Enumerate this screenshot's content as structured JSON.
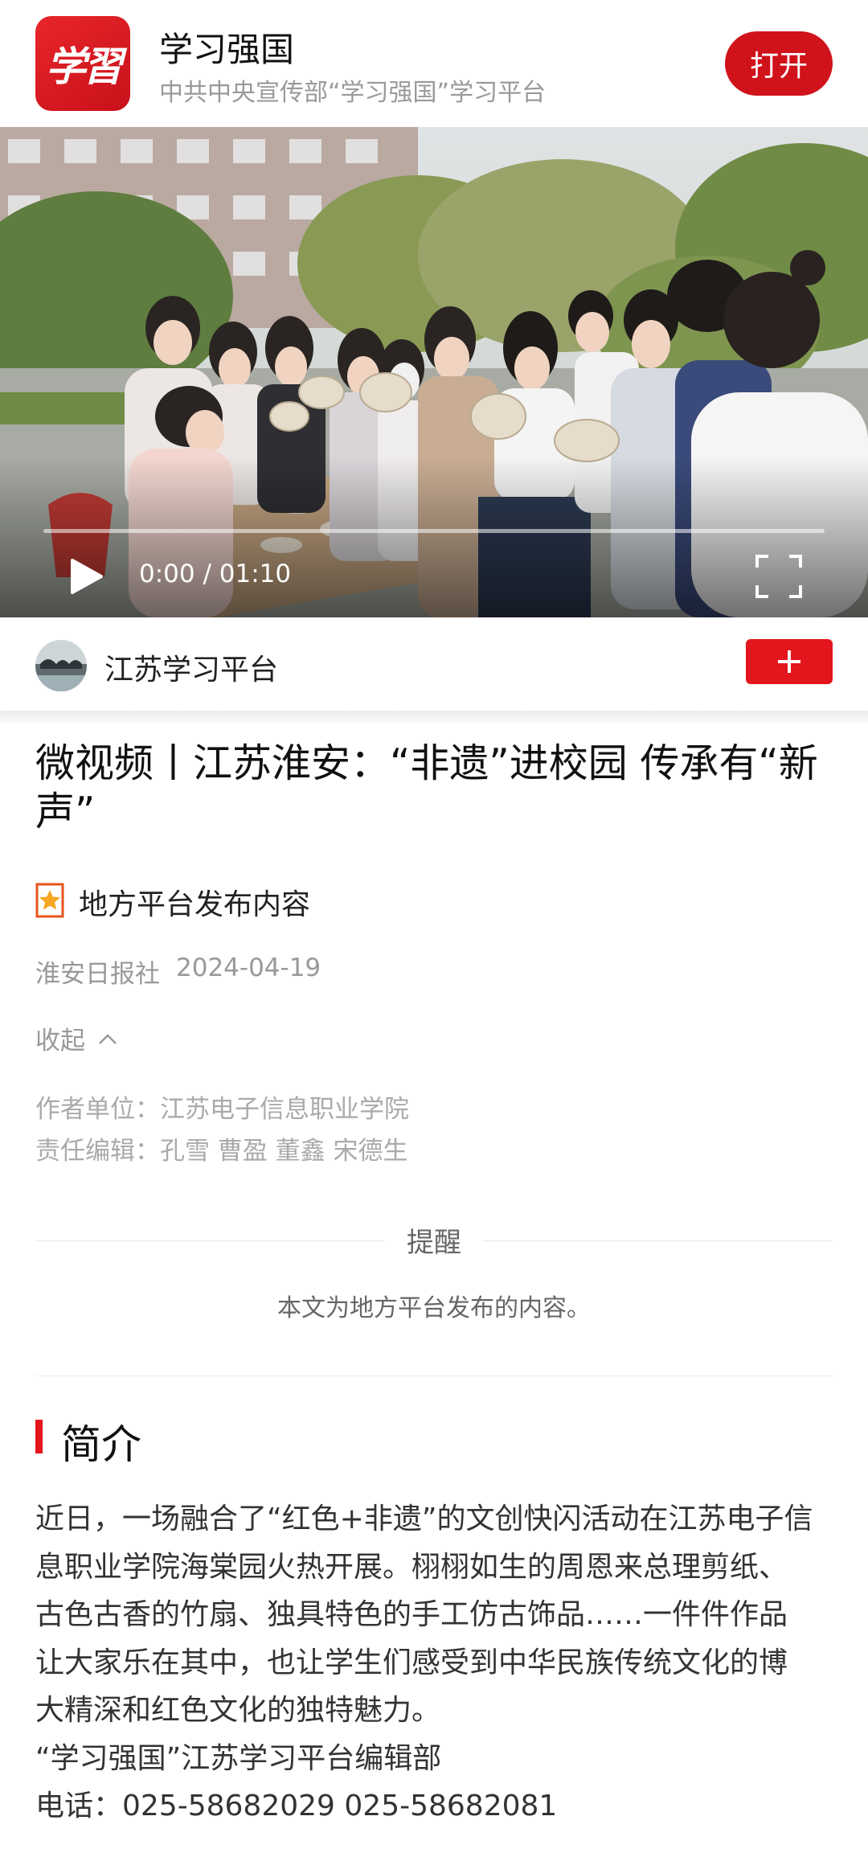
{
  "app_banner": {
    "logo_text": "学習",
    "name": "学习强国",
    "subtitle": "中共中央宣传部“学习强国”学习平台",
    "open_label": "打开"
  },
  "video": {
    "current_time": "0:00",
    "duration": "01:10",
    "time_display": "0:00 / 01:10",
    "progress": 0
  },
  "channel": {
    "name": "江苏学习平台",
    "follow_icon": "plus-icon"
  },
  "article": {
    "title": "微视频丨江苏淮安：“非遗”进校园 传承有“新声”",
    "source_label": "地方平台发布内容",
    "publisher": "淮安日报社",
    "date": "2024-04-19",
    "collapse_label": "收起",
    "author_unit": "作者单位：江苏电子信息职业学院",
    "editors": "责任编辑：孔雪 曹盈 董鑫 宋德生"
  },
  "notice": {
    "title": "提醒",
    "text": "本文为地方平台发布的内容。"
  },
  "intro": {
    "heading": "简介",
    "lines": [
      "近日，一场融合了“红色+非遗”的文创快闪活动在江苏电子信",
      "息职业学院海棠园火热开展。栩栩如生的周恩来总理剪纸、",
      "古色古香的竹扇、独具特色的手工仿古饰品……一件件作品",
      "让大家乐在其中，也让学生们感受到中华民族传统文化的博",
      "大精深和红色文化的独特魅力。",
      "“学习强国”江苏学习平台编辑部",
      "电话：025-58682029 025-58682081"
    ]
  },
  "colors": {
    "brand_red": "#d0121b",
    "follow_red": "#e3151d",
    "muted_text": "#999999"
  }
}
